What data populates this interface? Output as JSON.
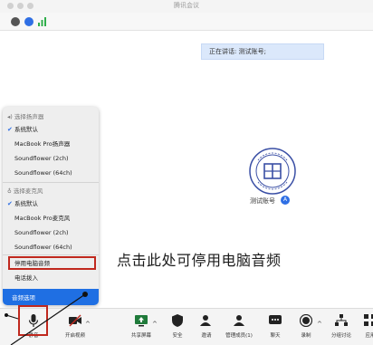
{
  "window": {
    "title": "腾讯会议"
  },
  "speaking": {
    "text": "正在讲话: 测试账号;"
  },
  "account": {
    "name": "测试账号",
    "badge_text": "A"
  },
  "callout": {
    "text": "点击此处可停用电脑音频"
  },
  "audio_menu": {
    "speaker_header": "选择扬声器",
    "speakers": [
      "系统默认",
      "MacBook Pro扬声器",
      "Soundflower (2ch)",
      "Soundflower (64ch)"
    ],
    "speaker_selected_index": 0,
    "mic_header": "选择麦克风",
    "mics": [
      "系统默认",
      "MacBook Pro麦克风",
      "Soundflower (2ch)",
      "Soundflower (64ch)"
    ],
    "mic_selected_index": 0,
    "stop_audio": "停用电脑音频",
    "phone_dial": "电话拨入",
    "test_audio": "音频选项"
  },
  "toolbar": {
    "mic_label": "静音",
    "video_label": "开启视频",
    "share_label": "共享屏幕",
    "security_label": "安全",
    "invite_label": "邀请",
    "manage_label": "管理成员(1)",
    "chat_label": "聊天",
    "record_label": "录制",
    "breakout_label": "分组讨论",
    "apps_label": "应用"
  },
  "colors": {
    "accent": "#1f6fe3",
    "highlight_box": "#c0281e",
    "speaking_bg": "#dbe8fb"
  }
}
